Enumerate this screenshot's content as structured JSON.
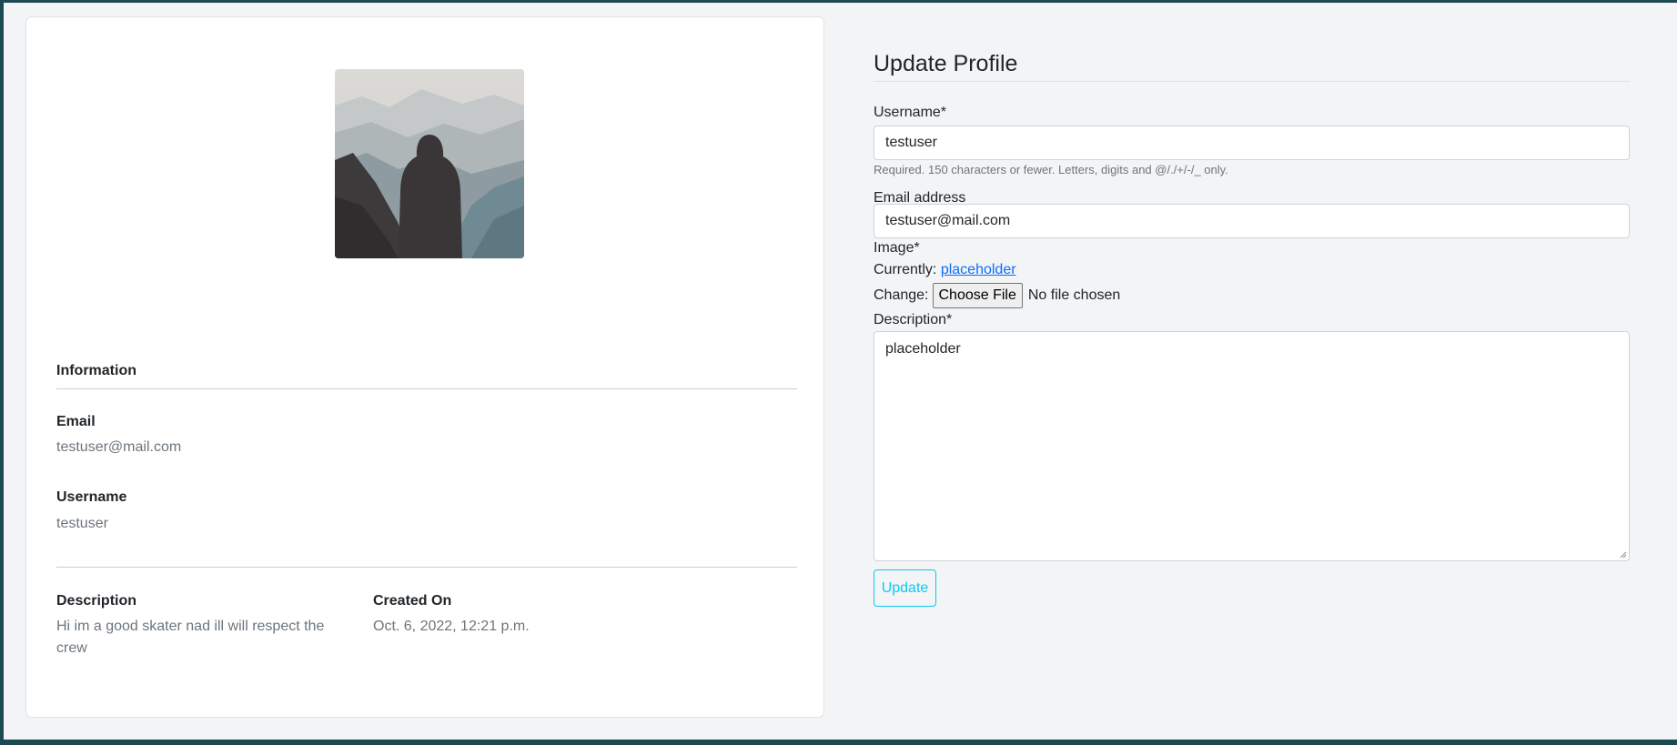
{
  "profile_card": {
    "avatar_alt": "profile picture",
    "information_title": "Information",
    "email_label": "Email",
    "email_value": "testuser@mail.com",
    "username_label": "Username",
    "username_value": "testuser",
    "description_label": "Description",
    "description_value": "Hi im a good skater nad ill will respect the crew",
    "created_label": "Created On",
    "created_value": "Oct. 6, 2022, 12:21 p.m."
  },
  "form": {
    "title": "Update Profile",
    "username_label": "Username*",
    "username_value": "testuser",
    "username_help": "Required. 150 characters or fewer. Letters, digits and @/./+/-/_ only.",
    "email_label": "Email address",
    "email_value": "testuser@mail.com",
    "image_label": "Image*",
    "currently_label": "Currently:",
    "currently_link": "placeholder",
    "change_label": "Change:",
    "choose_file_label": "Choose File",
    "no_file_text": "No file chosen",
    "description_label": "Description*",
    "description_value": "placeholder",
    "update_label": "Update"
  },
  "colors": {
    "outer_border": "#1d4a52",
    "page_bg": "#f2f4f6",
    "card_bg": "#ffffff",
    "muted_text": "#6c757d",
    "link": "#0d6efd",
    "info_outline": "#0dcaf0"
  }
}
